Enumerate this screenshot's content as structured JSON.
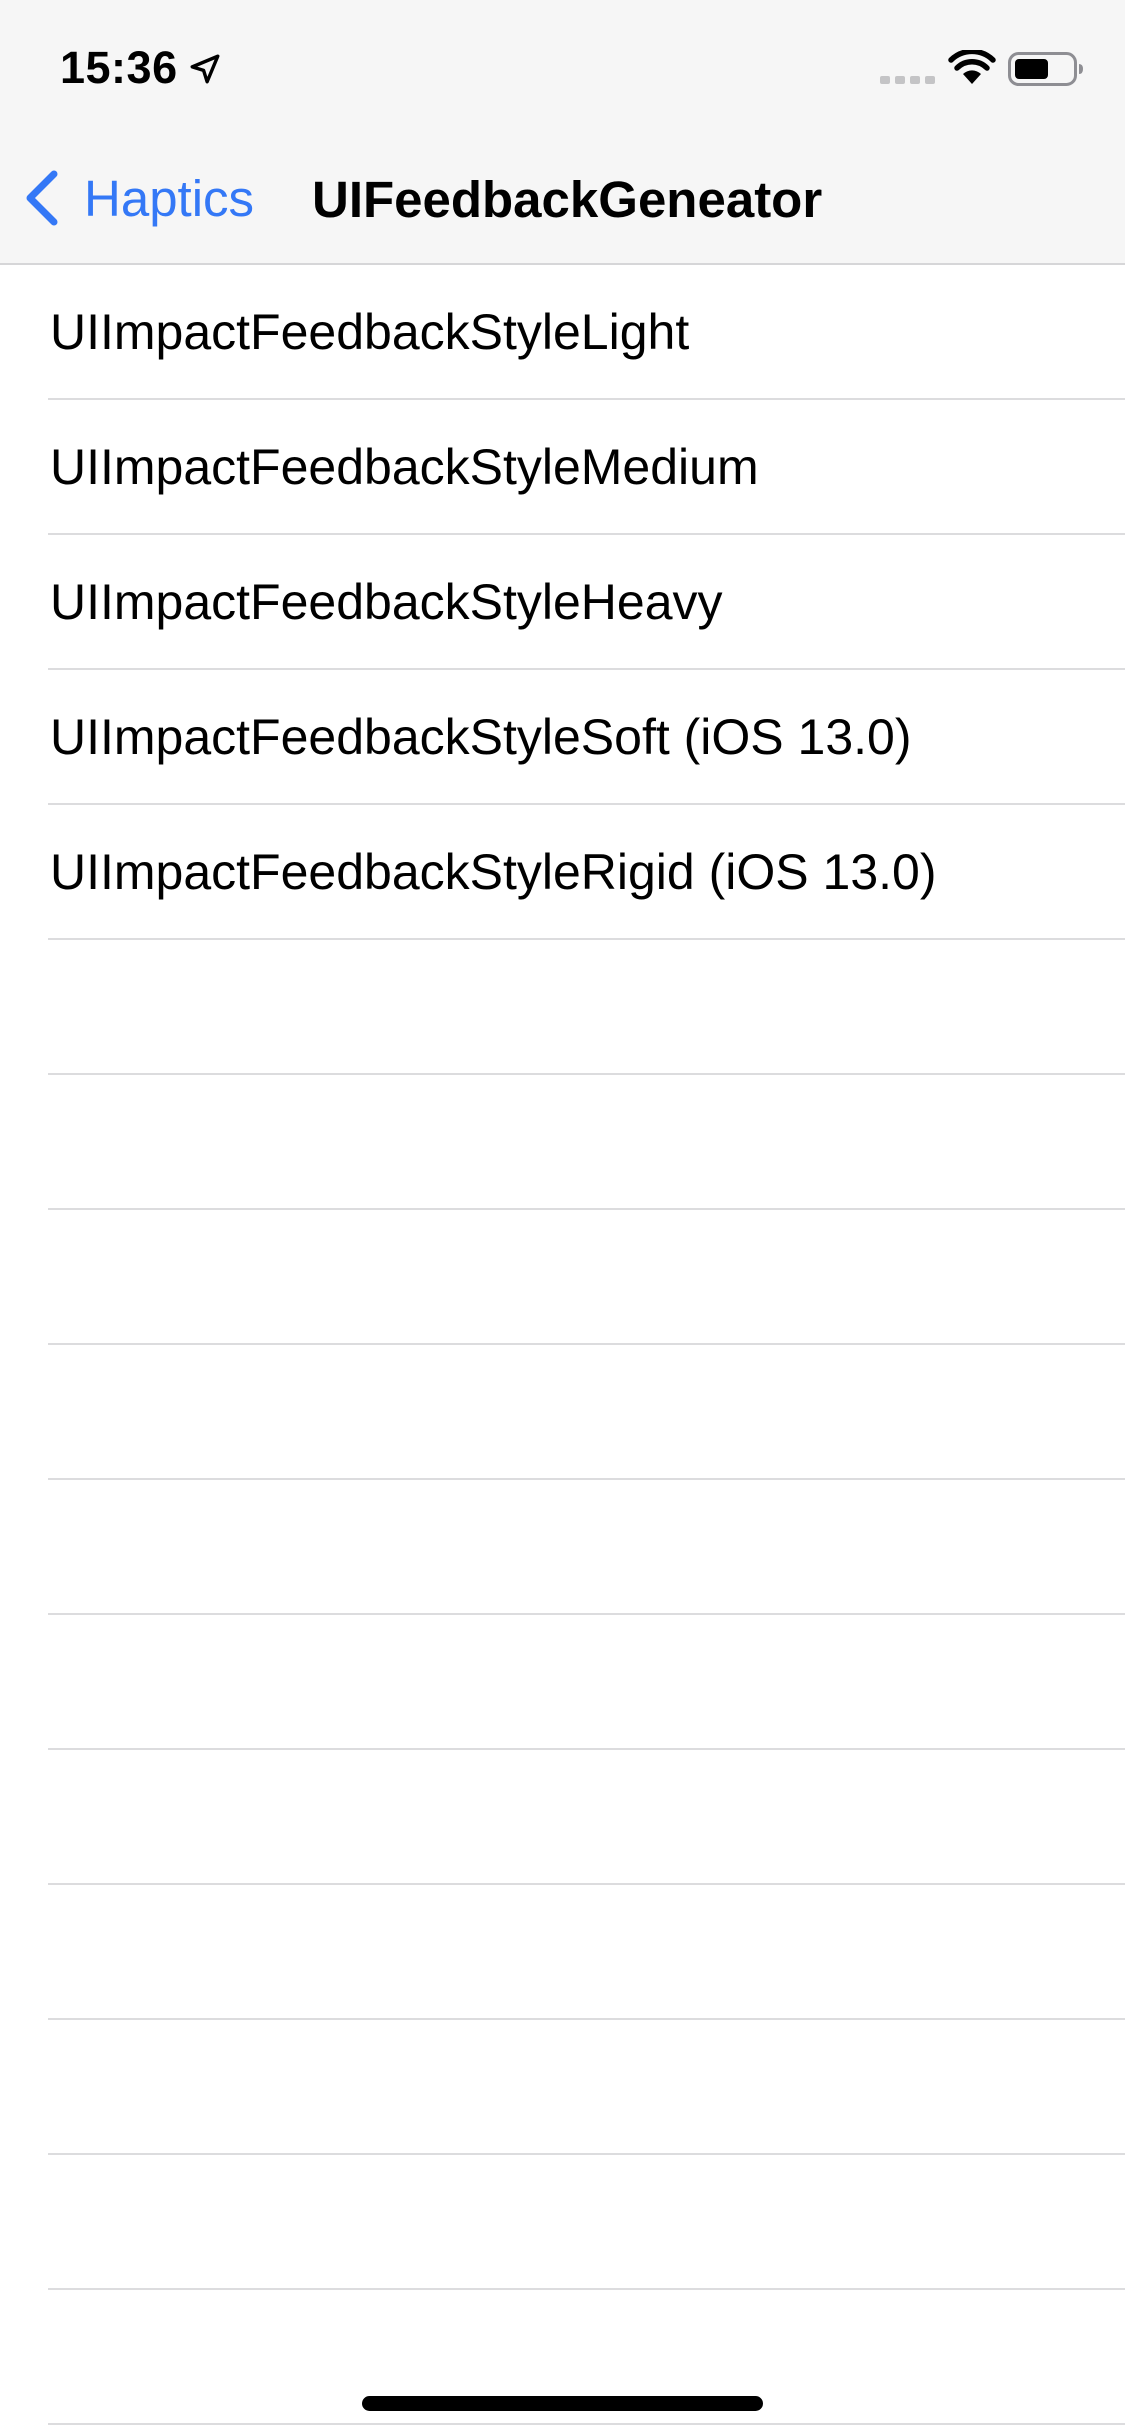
{
  "status_bar": {
    "time": "15:36",
    "icons": [
      "location-arrow-icon",
      "cellular-signal-icon",
      "wifi-icon",
      "battery-icon"
    ]
  },
  "nav_bar": {
    "back_label": "Haptics",
    "title": "UIFeedbackGeneator",
    "accent_color": "#3478f6"
  },
  "list": {
    "items": [
      {
        "label": "UIImpactFeedbackStyleLight"
      },
      {
        "label": "UIImpactFeedbackStyleMedium"
      },
      {
        "label": "UIImpactFeedbackStyleHeavy"
      },
      {
        "label": "UIImpactFeedbackStyleSoft (iOS 13.0)"
      },
      {
        "label": "UIImpactFeedbackStyleRigid (iOS 13.0)"
      }
    ],
    "empty_rows": 11
  }
}
